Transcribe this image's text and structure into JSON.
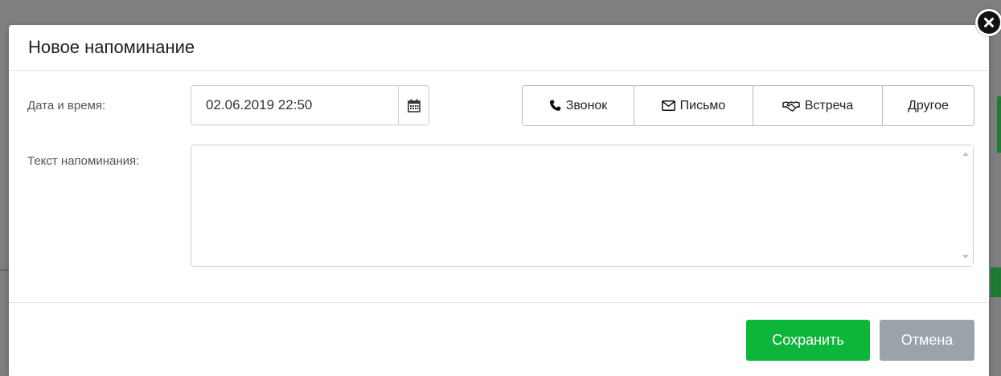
{
  "modal": {
    "title": "Новое напоминание"
  },
  "form": {
    "datetime_label": "Дата и время:",
    "datetime_value": "02.06.2019 22:50",
    "text_label": "Текст напоминания:",
    "text_value": ""
  },
  "reminder_types": [
    {
      "label": "Звонок",
      "icon": "phone-icon"
    },
    {
      "label": "Письмо",
      "icon": "envelope-icon"
    },
    {
      "label": "Встреча",
      "icon": "handshake-icon"
    },
    {
      "label": "Другое",
      "icon": ""
    }
  ],
  "footer": {
    "save_label": "Сохранить",
    "cancel_label": "Отмена"
  },
  "colors": {
    "save": "#0db53a",
    "cancel": "#9aa3aa",
    "overlay": "#7f7f7f"
  }
}
